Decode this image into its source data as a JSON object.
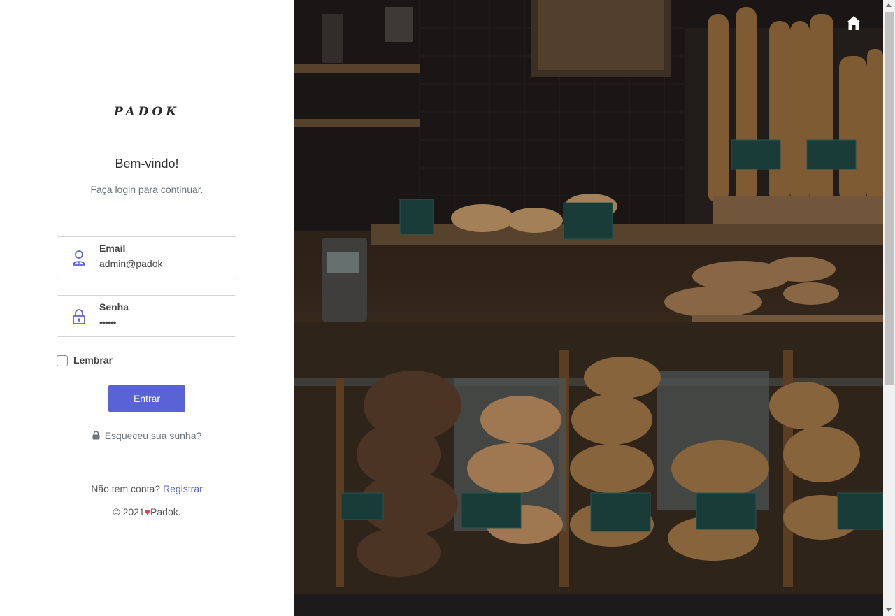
{
  "logo": {
    "text": "PADOK"
  },
  "welcome": {
    "title": "Bem-vindo!",
    "subtitle": "Faça login para continuar."
  },
  "form": {
    "email": {
      "label": "Email",
      "value": "admin@padok",
      "icon": "user-icon"
    },
    "password": {
      "label": "Senha",
      "value": "••••••",
      "icon": "lock-icon"
    },
    "remember": {
      "label": "Lembrar",
      "checked": false
    },
    "submit_label": "Entrar"
  },
  "forgot": {
    "label": "Esqueceu sua sunha?",
    "icon": "lock-icon"
  },
  "signup": {
    "prompt": "Não tem conta?",
    "link_label": "Registrar"
  },
  "footer": {
    "prefix": "© 2021",
    "brand": "Padok."
  },
  "hero": {
    "home_icon": "home-icon"
  },
  "colors": {
    "accent": "#5a63d6",
    "heart": "#e6394f",
    "muted": "#6c757d"
  }
}
